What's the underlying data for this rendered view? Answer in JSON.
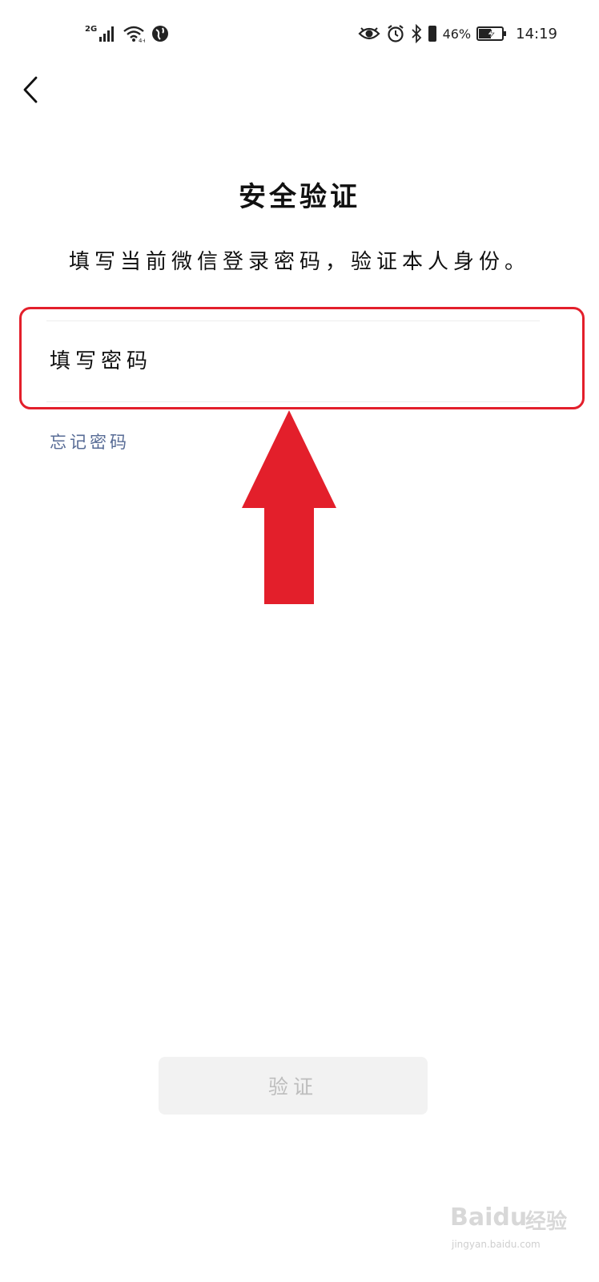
{
  "status_bar": {
    "network_type": "2G",
    "battery_percent": "46%",
    "time": "14:19",
    "icons": [
      "signal-icon",
      "wifi-icon",
      "vpn-globe-icon",
      "eye-comfort-icon",
      "alarm-icon",
      "bluetooth-icon",
      "vibrate-icon",
      "battery-icon"
    ]
  },
  "header": {
    "back_icon": "chevron-left-icon"
  },
  "main": {
    "title": "安全验证",
    "subtitle": "填写当前微信登录密码，验证本人身份。",
    "password_placeholder": "填写密码",
    "password_value": "",
    "forgot_link": "忘记密码"
  },
  "footer": {
    "verify_button": "验证"
  },
  "annotation": {
    "color": "#e31f2b",
    "arrow_icon": "arrow-up-icon"
  },
  "watermark": {
    "brand": "Bai",
    "brand_suffix": "du",
    "product": "经验",
    "url": "jingyan.baidu.com"
  },
  "colors": {
    "link": "#576b95",
    "button_bg": "#f2f2f2",
    "button_text": "#bdbdbd",
    "annotation_red": "#e31f2b"
  }
}
